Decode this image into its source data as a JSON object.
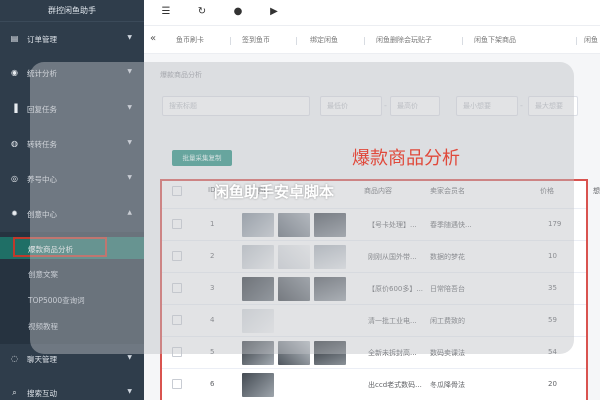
{
  "sidebar": {
    "brand": "群控闲鱼助手",
    "items": [
      {
        "label": "订单管理",
        "icon": "clipboard-icon"
      },
      {
        "label": "统计分析",
        "icon": "chart-icon"
      },
      {
        "label": "回复任务",
        "icon": "reply-icon"
      },
      {
        "label": "转转任务",
        "icon": "clock-icon"
      },
      {
        "label": "养号中心",
        "icon": "account-icon"
      },
      {
        "label": "创意中心",
        "icon": "bulb-icon"
      },
      {
        "label": "聊天管理",
        "icon": "chat-icon"
      },
      {
        "label": "搜索互动",
        "icon": "search-icon"
      }
    ],
    "submenu": [
      "爆款商品分析",
      "创意文案",
      "TOP5000查询词",
      "视频教程"
    ]
  },
  "topbar": {
    "icons": [
      "menu-icon",
      "refresh-icon",
      "record-icon",
      "play-icon"
    ]
  },
  "tabs": [
    "鱼币刷卡",
    "签到鱼币",
    "绑定闲鱼",
    "闲鱼删除会玩贴子",
    "闲鱼下架商品",
    "闲鱼"
  ],
  "page": {
    "breadcrumb": "爆款商品分析",
    "filters": {
      "keyword_placeholder": "搜索标题",
      "min_price": "最低价",
      "max_price": "最高价",
      "min_want": "最小想要",
      "max_want": "最大想要"
    },
    "bulk_button": "批量采集复制",
    "section_title": "爆款商品分析",
    "watermark": "闲鱼助手安卓脚本"
  },
  "table": {
    "headers": [
      "ID",
      "图片",
      "商品内容",
      "卖家会员名",
      "价格",
      "想"
    ],
    "rows": [
      {
        "id": "1",
        "content": "【号卡处理】...",
        "seller": "春季随遇快...",
        "price": "179"
      },
      {
        "id": "2",
        "content": "刚刚从国外带...",
        "seller": "数据的梦花",
        "price": "10"
      },
      {
        "id": "3",
        "content": "【原价600多】...",
        "seller": "日常陪吾台",
        "price": "35"
      },
      {
        "id": "4",
        "content": "清一批工业电...",
        "seller": "闲工费致的",
        "price": "59"
      },
      {
        "id": "5",
        "content": "全新未拆封高...",
        "seller": "数码卖课法",
        "price": "54"
      },
      {
        "id": "6",
        "content": "出ccd老式数码...",
        "seller": "冬瓜降骨法",
        "price": "20"
      }
    ]
  },
  "colors": {
    "sidebar_bg": "#2f3d4b",
    "accent": "#1f8f7f",
    "highlight_red": "#e0493b"
  }
}
